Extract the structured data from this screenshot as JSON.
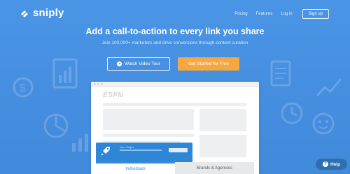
{
  "brand": {
    "name": "sniply"
  },
  "nav": {
    "links": [
      "Pricing",
      "Features",
      "Log in"
    ],
    "signup": "Sign up"
  },
  "hero": {
    "headline": "Add a call-to-action to every link you share",
    "subline": "Join 100,000+ marketers and drive conversions through content curation",
    "tour_button": "Watch Video Tour",
    "start_button": "Get Started for Free"
  },
  "mockup": {
    "site_logo": "ESPN",
    "cta_text": "Your Snip's"
  },
  "tabs": [
    {
      "label": "Individuals",
      "active": true
    },
    {
      "label": "Brands & Agencies",
      "active": false
    }
  ],
  "help": {
    "label": "Help",
    "icon": "question-icon"
  },
  "colors": {
    "hero_bg": "#4a90e2",
    "accent": "#f5a742",
    "tab_active": "#3a8fd9"
  }
}
